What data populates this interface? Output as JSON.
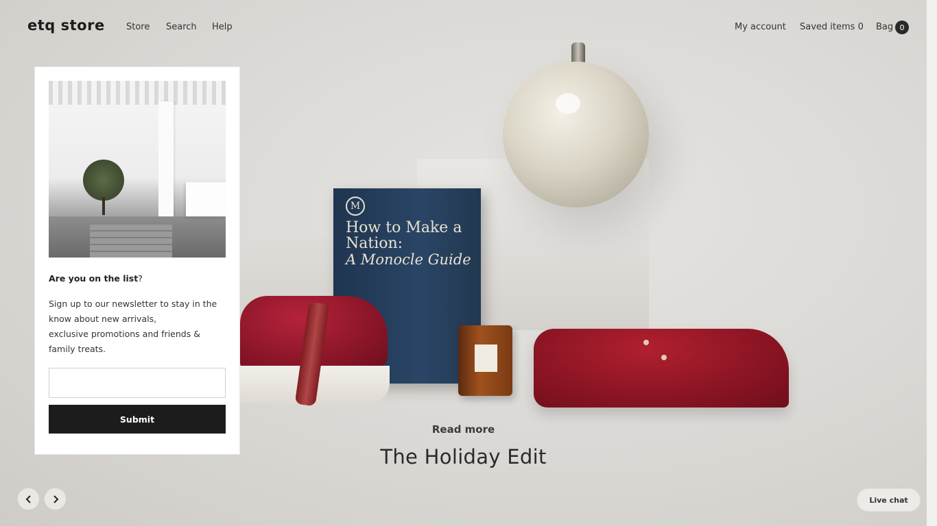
{
  "header": {
    "logo": "etq store",
    "nav": [
      "Store",
      "Search",
      "Help"
    ],
    "my_account": "My account",
    "saved_items": "Saved items 0",
    "bag": "Bag",
    "bag_count": "0"
  },
  "hero": {
    "read_more": "Read more",
    "title": "The Holiday Edit",
    "book_title": "How to Make a Nation:",
    "book_subtitle": "A Monocle Guide",
    "book_logo": "M"
  },
  "newsletter": {
    "heading_bold": "Are you on the list",
    "heading_end": "?",
    "text_line1": "Sign up to our newsletter to stay in the know about new arrivals,",
    "text_line2": "exclusive promotions and friends & family treats.",
    "email_placeholder": "",
    "submit_label": "Submit"
  },
  "controls": {
    "prev_icon": "chevron-left-icon",
    "next_icon": "chevron-right-icon",
    "live_chat": "Live chat"
  },
  "colors": {
    "button_dark": "#1c1c1c",
    "hero_background": "#dcdad6"
  }
}
